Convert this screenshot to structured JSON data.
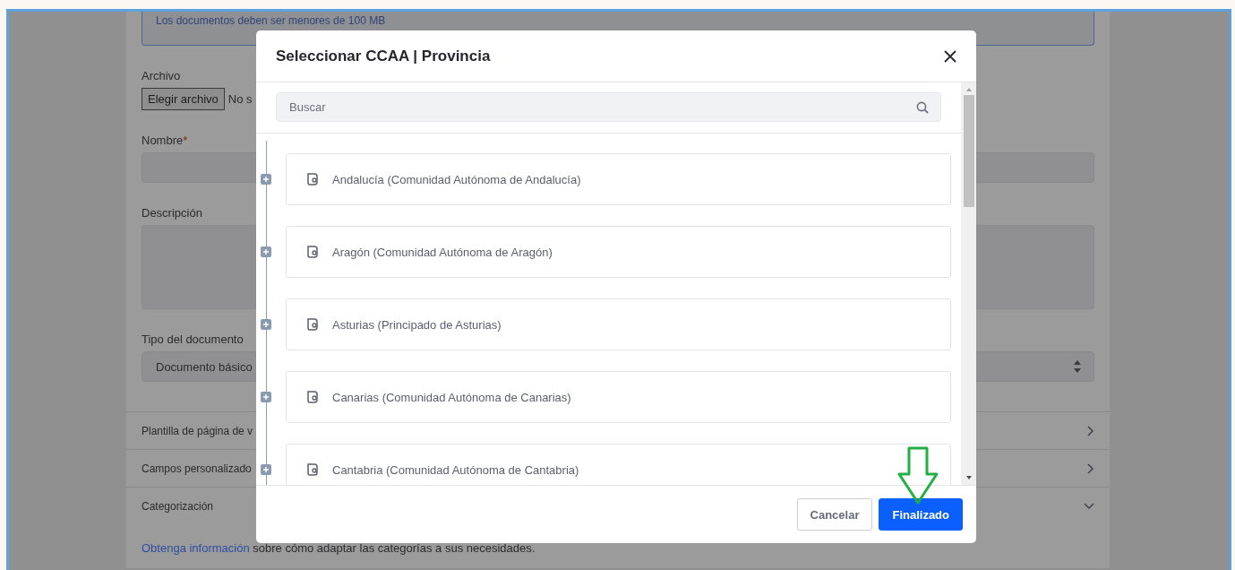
{
  "form": {
    "notice": "Los documentos deben ser menores de 100 MB",
    "file_label": "Archivo",
    "file_button": "Elegir archivo",
    "file_status": "No s",
    "name_label": "Nombre",
    "required_mark": "*",
    "description_label": "Descripción",
    "type_label": "Tipo del documento",
    "type_value": "Documento básico",
    "sections": [
      {
        "label": "Plantilla de página de v",
        "expanded": false
      },
      {
        "label": "Campos personalizado",
        "expanded": false
      },
      {
        "label": "Categorización",
        "expanded": true
      }
    ],
    "help_link": "Obtenga información",
    "help_text": "sobre cómo adaptar las categorías a sus necesidades."
  },
  "dialog": {
    "title": "Seleccionar CCAA | Provincia",
    "search": {
      "placeholder": "Buscar"
    },
    "items": [
      {
        "label": "Andalucía (Comunidad Autónoma de Andalucía)",
        "expanded": false
      },
      {
        "label": "Aragón (Comunidad Autónoma de Aragón)",
        "expanded": false
      },
      {
        "label": "Asturias (Principado de Asturias)",
        "expanded": false
      },
      {
        "label": "Canarias (Comunidad Autónoma de Canarias)",
        "expanded": false
      },
      {
        "label": "Cantabria (Comunidad Autónoma de Cantabria)",
        "expanded": false
      }
    ],
    "buttons": [
      {
        "label": "Cancelar",
        "kind": "secondary"
      },
      {
        "label": "Finalizado",
        "kind": "primary"
      }
    ]
  }
}
